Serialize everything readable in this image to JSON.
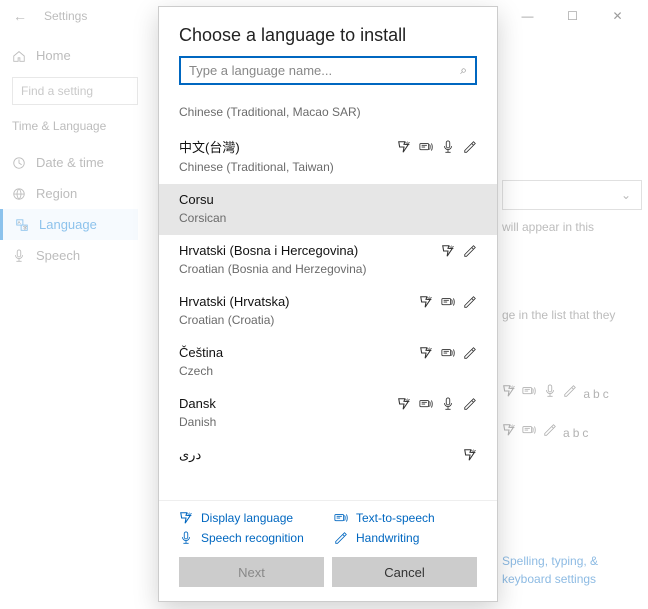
{
  "window": {
    "app": "Settings"
  },
  "winbtns": {
    "min": "—",
    "max": "☐",
    "close": "✕"
  },
  "sidebar": {
    "home": "Home",
    "search_placeholder": "Find a setting",
    "group": "Time & Language",
    "items": [
      {
        "icon": "clock",
        "label": "Date & time"
      },
      {
        "icon": "globe",
        "label": "Region"
      },
      {
        "icon": "lang",
        "label": "Language"
      },
      {
        "icon": "mic",
        "label": "Speech"
      }
    ]
  },
  "modal": {
    "title": "Choose a language to install",
    "search_placeholder": "Type a language name...",
    "rows": [
      {
        "native": "",
        "english": "Chinese (Traditional, Macao SAR)",
        "features": []
      },
      {
        "native": "中文(台灣)",
        "english": "Chinese (Traditional, Taiwan)",
        "features": [
          "display",
          "tts",
          "speech",
          "hand"
        ]
      },
      {
        "native": "Corsu",
        "english": "Corsican",
        "features": [],
        "hover": true
      },
      {
        "native": "Hrvatski (Bosna i Hercegovina)",
        "english": "Croatian (Bosnia and Herzegovina)",
        "features": [
          "display",
          "hand"
        ]
      },
      {
        "native": "Hrvatski (Hrvatska)",
        "english": "Croatian (Croatia)",
        "features": [
          "display",
          "tts",
          "hand"
        ]
      },
      {
        "native": "Čeština",
        "english": "Czech",
        "features": [
          "display",
          "tts",
          "hand"
        ]
      },
      {
        "native": "Dansk",
        "english": "Danish",
        "features": [
          "display",
          "tts",
          "speech",
          "hand"
        ]
      },
      {
        "native": "درى",
        "english": "",
        "features": [
          "display"
        ]
      }
    ],
    "legend": {
      "display": "Display language",
      "tts": "Text-to-speech",
      "speech": "Speech recognition",
      "hand": "Handwriting"
    },
    "next": "Next",
    "cancel": "Cancel"
  },
  "peek": {
    "line1": "will appear in this",
    "line2": "ge in the list that they",
    "link": "Spelling, typing, & keyboard settings"
  }
}
